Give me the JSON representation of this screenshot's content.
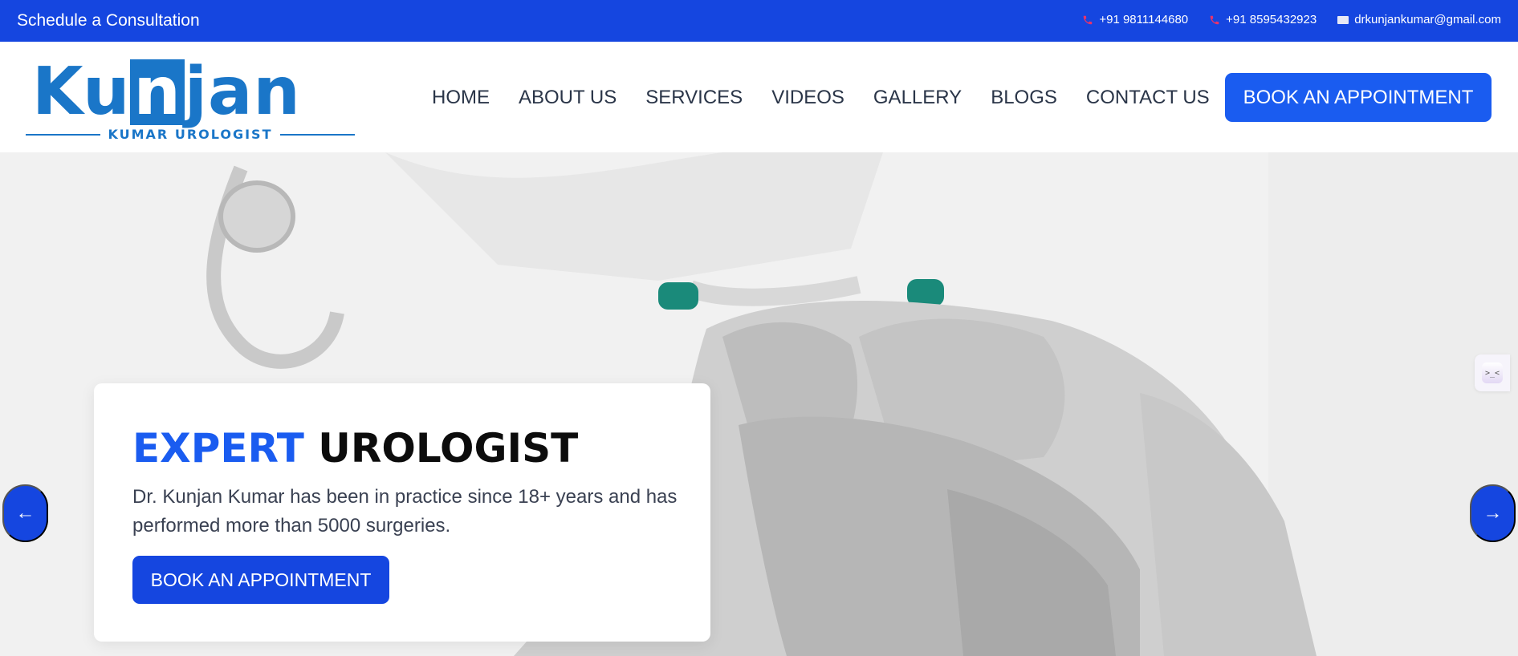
{
  "topbar": {
    "cta_label": "Schedule a Consultation",
    "phone1": "+91 9811144680",
    "phone2": "+91 8595432923",
    "email": "drkunjankumar@gmail.com"
  },
  "brand": {
    "name_part1": "Ku",
    "name_box": "n",
    "name_part2": "jan",
    "tagline": "KUMAR UROLOGIST"
  },
  "nav": {
    "items": [
      {
        "label": "HOME"
      },
      {
        "label": "ABOUT US"
      },
      {
        "label": "SERVICES"
      },
      {
        "label": "VIDEOS"
      },
      {
        "label": "GALLERY"
      },
      {
        "label": "BLOGS"
      },
      {
        "label": "CONTACT US"
      }
    ],
    "book_label": "BOOK AN APPOINTMENT"
  },
  "hero": {
    "title_accent": "EXPERT",
    "title_rest": "UROLOGIST",
    "description": "Dr. Kunjan Kumar has been in practice since 18+ years and has performed more than 5000 surgeries.",
    "button_label": "BOOK AN APPOINTMENT",
    "prev_arrow": "←",
    "next_arrow": "→"
  },
  "colors": {
    "primary": "#1546e0",
    "accent": "#1a5cf0",
    "brand": "#1a76c8",
    "phone_icon": "#e8336a"
  }
}
